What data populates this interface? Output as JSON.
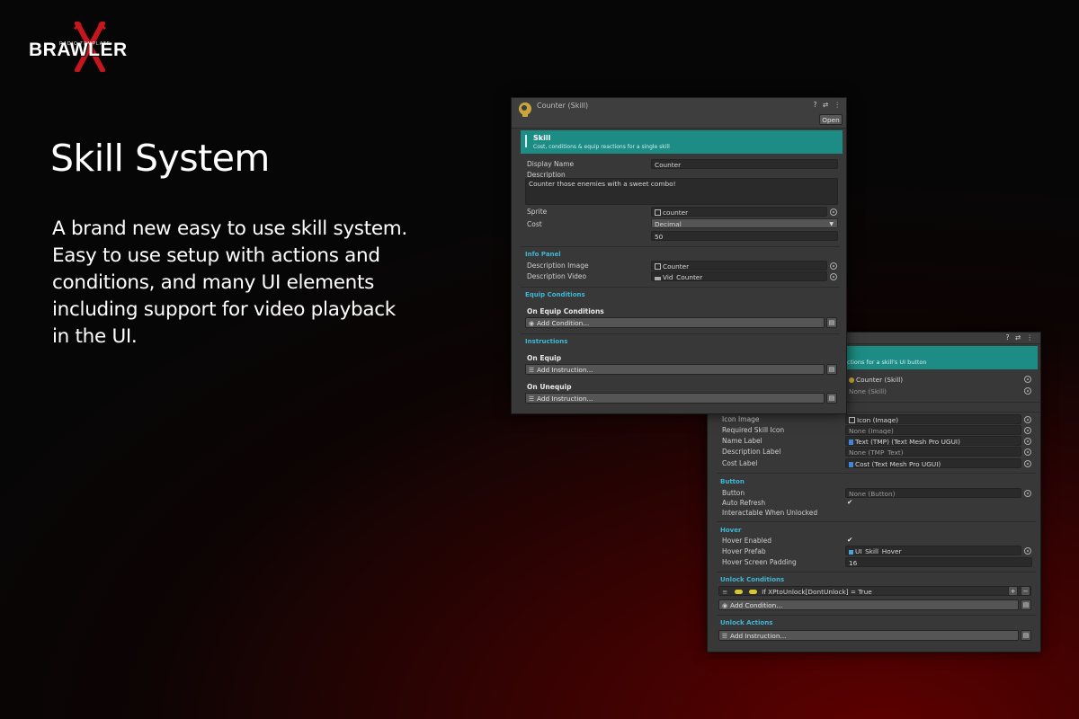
{
  "brand": {
    "logo_text": "BRAWLER",
    "logo_tagline": "RADIO TEMPLATE"
  },
  "hero": {
    "title": "Skill System",
    "lines": [
      "A brand new easy to use skill system.",
      "Easy to use setup with actions and",
      "conditions, and many UI elements",
      "including support for video playback",
      "in the UI."
    ]
  },
  "colors": {
    "accent_teal": "#1c8c84",
    "section_label": "#3fb8d6",
    "panel_bg": "#383838"
  },
  "skill_inspector": {
    "title": "Counter (Skill)",
    "open_button": "Open",
    "header_icons": "? ⇄ ⋮",
    "banner": {
      "title": "Skill",
      "subtitle": "Cost, conditions & equip reactions for a single skill"
    },
    "display_name_label": "Display Name",
    "display_name_value": "Counter",
    "description_label": "Description",
    "description_value": "Counter those enemies with a sweet combo!",
    "sprite_label": "Sprite",
    "sprite_value": "counter",
    "cost_label": "Cost",
    "cost_type": "Decimal",
    "cost_value": "50",
    "info_panel_section": "Info Panel",
    "description_image_label": "Description Image",
    "description_image_value": "Counter",
    "description_video_label": "Description Video",
    "description_video_value": "Vid_Counter",
    "equip_conditions_section": "Equip Conditions",
    "on_equip_conditions": "On Equip Conditions",
    "add_condition": "Add Condition...",
    "instructions_section": "Instructions",
    "on_equip": "On Equip",
    "add_instruction_1": "Add Instruction...",
    "on_unequip": "On Unequip",
    "add_instruction_2": "Add Instruction..."
  },
  "button_inspector": {
    "header_icons": "? ⇄ ⋮",
    "banner_subtitle": "ctions for a skill's UI button",
    "skill_ref_value": "Counter (Skill)",
    "skill_ref2_value": "None (Skill)",
    "icon_image_label": "Icon Image",
    "icon_image_value": "Icon (Image)",
    "required_skill_icon_label": "Required Skill Icon",
    "required_skill_icon_value": "None (Image)",
    "name_label_label": "Name Label",
    "name_label_value": "Text (TMP) (Text Mesh Pro UGUI)",
    "description_label_label": "Description Label",
    "description_label_value": "None (TMP_Text)",
    "cost_label_label": "Cost Label",
    "cost_label_value": "Cost (Text Mesh Pro UGUI)",
    "button_section": "Button",
    "button_label": "Button",
    "button_value": "None (Button)",
    "auto_refresh_label": "Auto Refresh",
    "interactable_label": "Interactable When Unlocked",
    "hover_section": "Hover",
    "hover_enabled_label": "Hover Enabled",
    "hover_prefab_label": "Hover Prefab",
    "hover_prefab_value": "UI_Skill_Hover",
    "hover_padding_label": "Hover Screen Padding",
    "hover_padding_value": "16",
    "unlock_conditions_section": "Unlock Conditions",
    "condition_text": "If XPtoUnlock[DontUnlock] = True",
    "add_condition": "Add Condition...",
    "unlock_actions_section": "Unlock Actions",
    "add_instruction": "Add Instruction..."
  }
}
